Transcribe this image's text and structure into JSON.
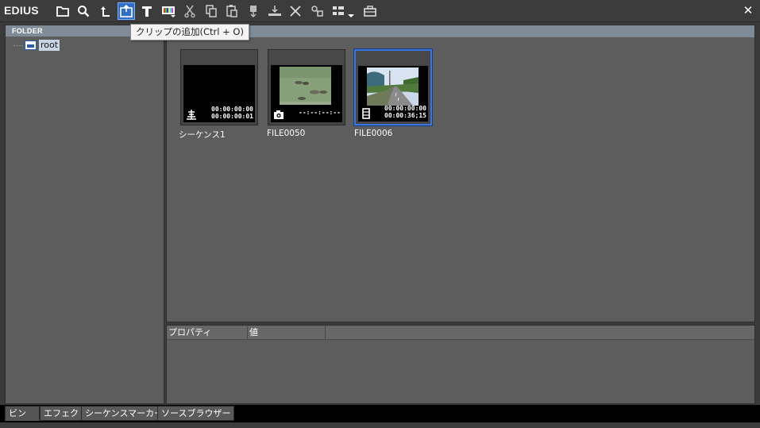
{
  "app": {
    "title": "EDIUS"
  },
  "toolbar": {
    "icons": [
      "folder-icon",
      "search-icon",
      "up-folder-icon",
      "add-clip-icon",
      "title-icon",
      "color-bar-icon",
      "cut-icon",
      "copy-icon",
      "paste-icon",
      "marker-icon",
      "insert-timeline-icon",
      "delete-icon",
      "properties-icon",
      "view-icon",
      "bin-menu-icon"
    ],
    "active_icon": "add-clip-icon",
    "close_label": "✕"
  },
  "tooltip": {
    "text": "クリップの追加(Ctrl + O)"
  },
  "folder_pane": {
    "header": "FOLDER",
    "tree": [
      {
        "label": "root",
        "selected": true
      }
    ]
  },
  "bin": {
    "clips": [
      {
        "name": "シーケンス1",
        "type": "sequence",
        "tc_in": "00:00:00:00",
        "tc_dur": "00:00:00:01",
        "selected": false
      },
      {
        "name": "FILE0050",
        "type": "still",
        "tc_in": "--:--:--:--",
        "tc_dur": "",
        "selected": false
      },
      {
        "name": "FILE0006",
        "type": "video",
        "tc_in": "00:00:00:00",
        "tc_dur": "00:00:36;15",
        "selected": true
      }
    ]
  },
  "properties": {
    "columns": [
      "プロパティ",
      "値"
    ]
  },
  "bottom_tabs": [
    {
      "label": "ビン",
      "active": true
    },
    {
      "label": "エフェクト",
      "active": false
    },
    {
      "label": "シーケンスマーカー",
      "active": false
    },
    {
      "label": "ソースブラウザー",
      "active": false
    }
  ],
  "colors": {
    "selection_blue": "#3a76e2",
    "header_bar": "#7f8c98",
    "panel_bg": "#5d5d5e"
  }
}
